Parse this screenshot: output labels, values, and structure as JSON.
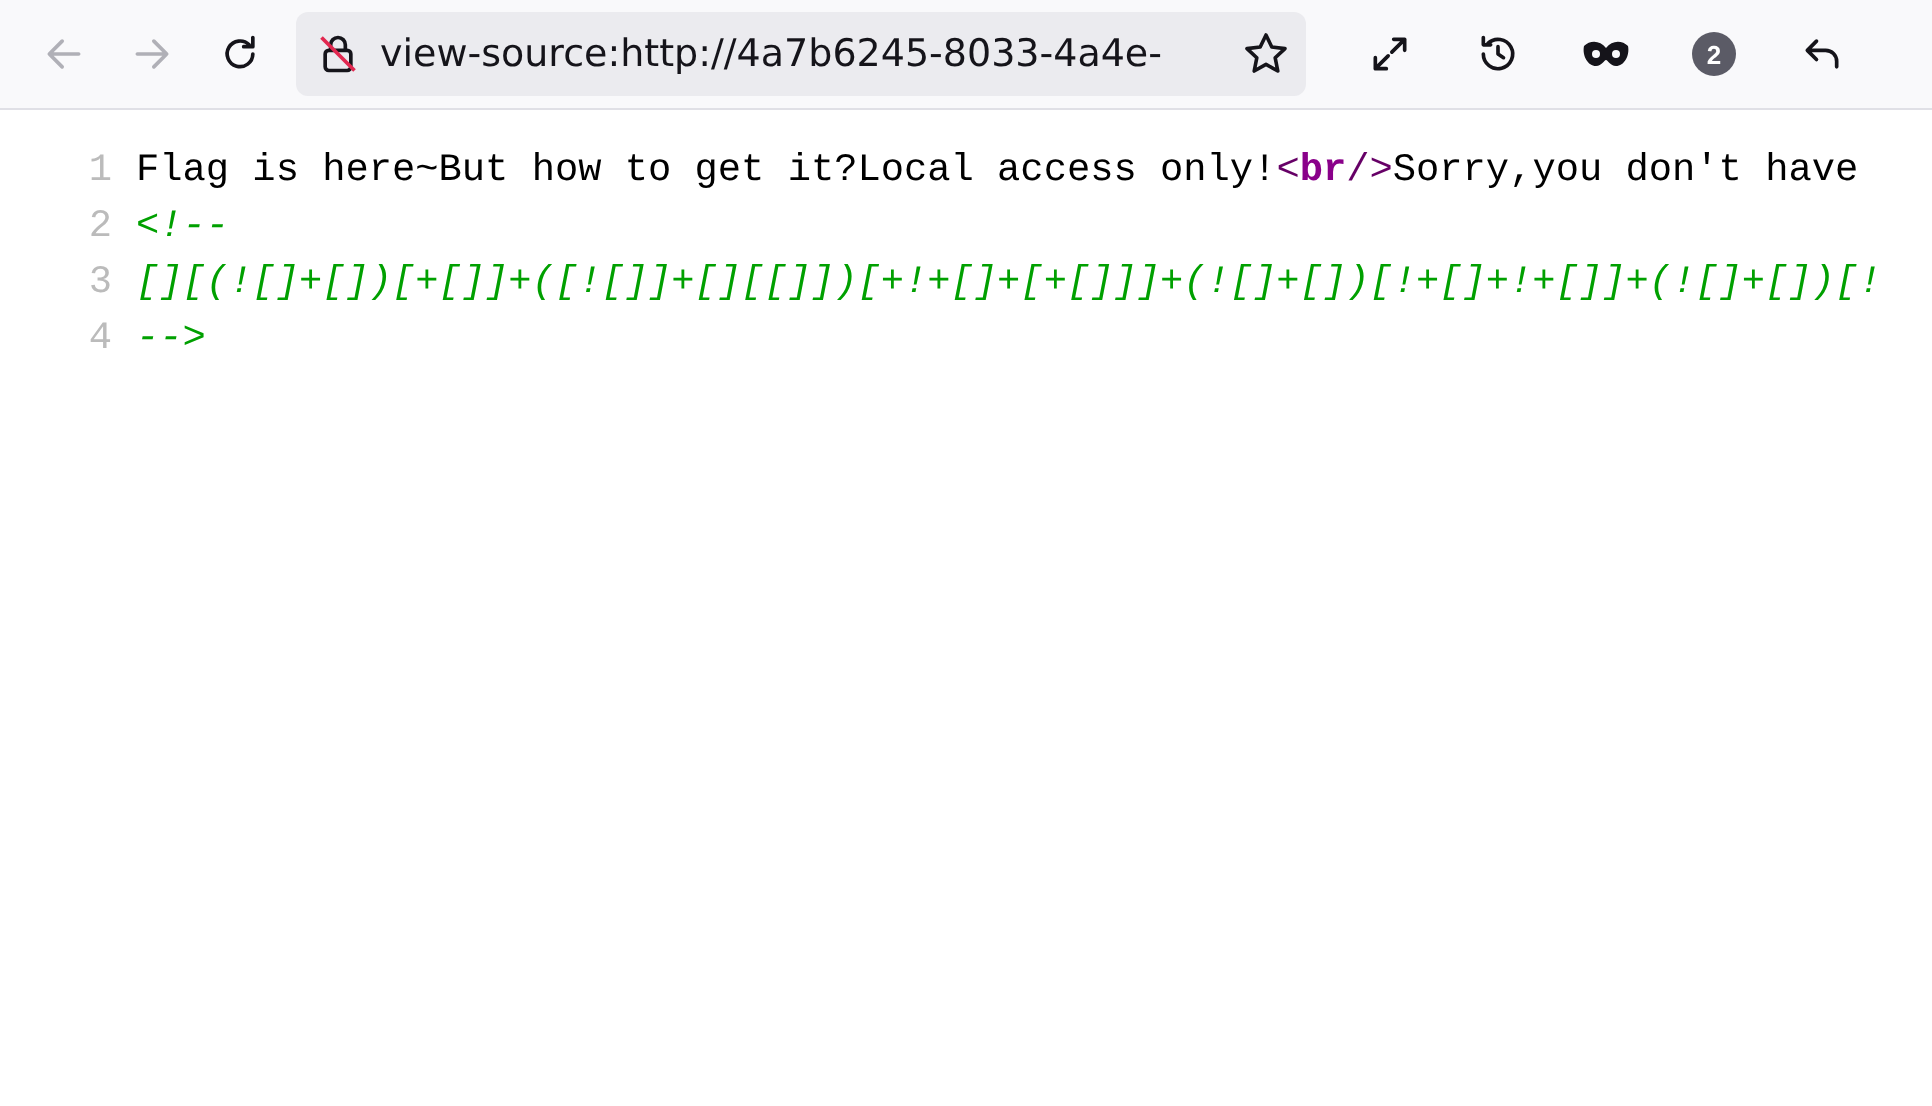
{
  "toolbar": {
    "nav_buttons": [
      {
        "kind": "back",
        "disabled": true
      },
      {
        "kind": "forward",
        "disabled": true
      },
      {
        "kind": "reload",
        "disabled": false
      }
    ],
    "address_bar": {
      "value": "view-source:http://4a7b6245-8033-4a4e-"
    },
    "actions": [
      {
        "kind": "expand"
      },
      {
        "kind": "history"
      },
      {
        "kind": "mask"
      },
      {
        "kind": "badge",
        "label": "2"
      },
      {
        "kind": "undo"
      }
    ]
  },
  "source_lines": [
    {
      "number": "1",
      "segments": [
        {
          "kind": "text",
          "text": "Flag is here~But how to get it?Local access only!"
        },
        {
          "kind": "bracket",
          "text": "<"
        },
        {
          "kind": "tag",
          "text": "br"
        },
        {
          "kind": "bracket",
          "text": "/>"
        },
        {
          "kind": "text",
          "text": "Sorry,you don't have"
        }
      ]
    },
    {
      "number": "2",
      "segments": [
        {
          "kind": "comment",
          "text": "<!--"
        }
      ]
    },
    {
      "number": "3",
      "segments": [
        {
          "kind": "comment",
          "text": "[][(![]+[])[+[]]+([![]]+[][[]])[+!+[]+[+[]]]+(![]+[])[!+[]+!+[]]+(![]+[])[!"
        }
      ]
    },
    {
      "number": "4",
      "segments": [
        {
          "kind": "comment",
          "text": "-->"
        }
      ]
    }
  ]
}
